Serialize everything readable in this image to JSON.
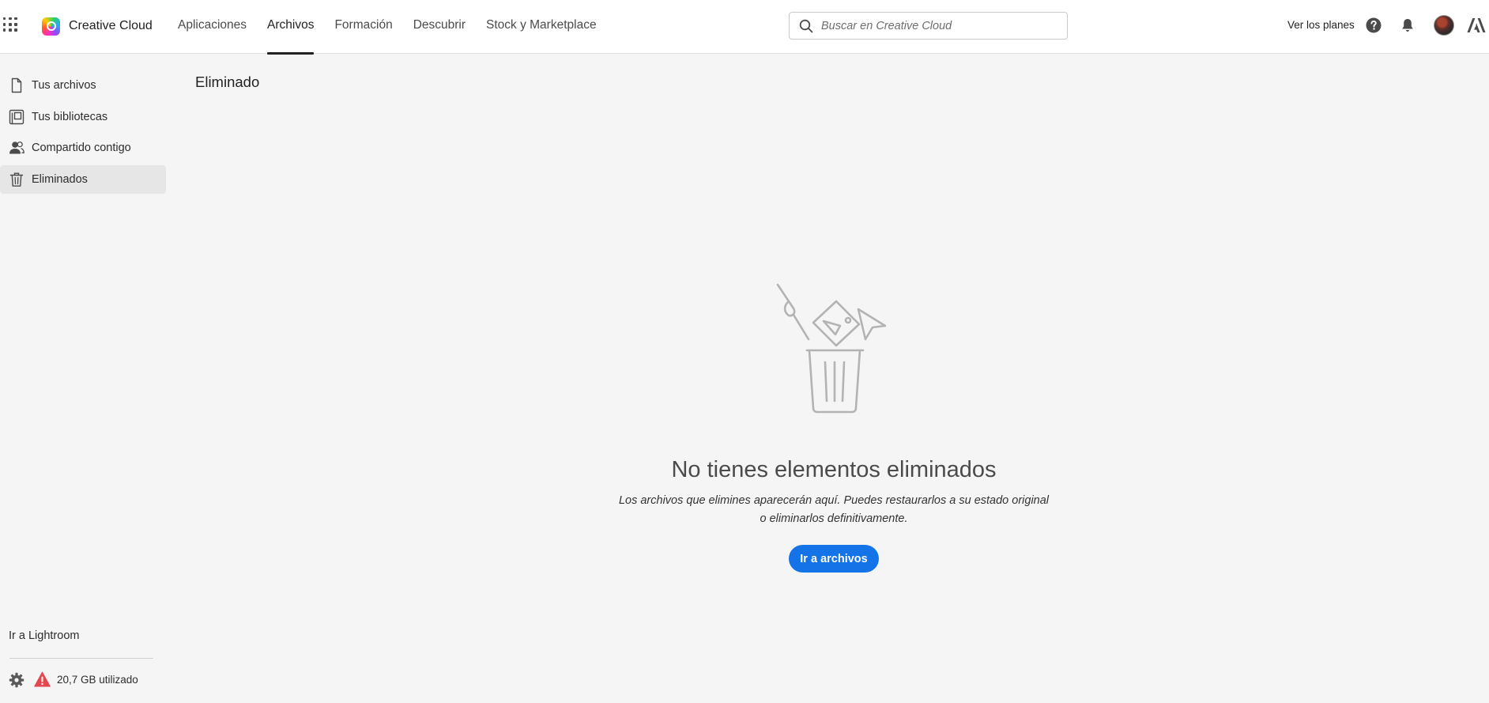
{
  "header": {
    "app_switcher_icon": "grid-icon",
    "brand_name": "Creative Cloud",
    "nav_tabs": [
      {
        "label": "Aplicaciones",
        "active": false
      },
      {
        "label": "Archivos",
        "active": true
      },
      {
        "label": "Formación",
        "active": false
      },
      {
        "label": "Descubrir",
        "active": false
      },
      {
        "label": "Stock y Marketplace",
        "active": false
      }
    ],
    "search": {
      "placeholder": "Buscar en Creative Cloud",
      "value": ""
    },
    "plans_link": "Ver los planes",
    "icons": [
      "help-icon",
      "bell-icon",
      "avatar",
      "adobe-logo-icon"
    ]
  },
  "sidebar": {
    "items": [
      {
        "label": "Tus archivos",
        "icon": "file-icon",
        "active": false
      },
      {
        "label": "Tus bibliotecas",
        "icon": "library-icon",
        "active": false
      },
      {
        "label": "Compartido contigo",
        "icon": "people-icon",
        "active": false
      },
      {
        "label": "Eliminados",
        "icon": "trash-icon",
        "active": true
      }
    ],
    "lightroom_link": "Ir a Lightroom",
    "storage_text": "20,7 GB utilizado",
    "storage_status_color": "#e34850"
  },
  "main": {
    "page_title": "Eliminado",
    "empty_state": {
      "title": "No tienes elementos eliminados",
      "description": "Los archivos que elimines aparecerán aquí. Puedes restaurarlos a su estado original o eliminarlos definitivamente.",
      "button_label": "Ir a archivos"
    }
  },
  "colors": {
    "accent": "#1473e6",
    "background": "#f5f5f5",
    "header_bg": "#ffffff",
    "sidebar_active": "#e6e6e6"
  }
}
